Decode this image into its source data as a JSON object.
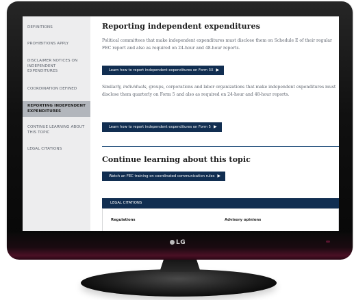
{
  "tv": {
    "brand": "LG"
  },
  "sidebar": {
    "items": [
      {
        "label": "DEFINITIONS",
        "active": false
      },
      {
        "label": "PROHIBITIONS APPLY",
        "active": false
      },
      {
        "label": "DISCLAIMER NOTICES ON INDEPENDENT EXPENDITURES",
        "active": false
      },
      {
        "label": "COORDINATION DEFINED",
        "active": false
      },
      {
        "label": "REPORTING INDEPENDENT EXPENDITURES",
        "active": true
      },
      {
        "label": "CONTINUE LEARNING ABOUT THIS TOPIC",
        "active": false
      },
      {
        "label": "LEGAL CITATIONS",
        "active": false
      }
    ]
  },
  "main": {
    "heading": "Reporting independent expenditures",
    "para1": "Political committees that make independent expenditures must disclose them on Schedule E of their regular FEC report and also as required on 24-hour and 48-hour reports.",
    "button1": "Learn how to report independent expenditures on Form 3X",
    "para2_lead": "Similarly, ",
    "para2_em": "individuals",
    "para2_rest": ", groups, corporations and labor organizations that make independent expenditures must disclose them quarterly on Form 5 and also as required on 24-hour and 48-hour reports.",
    "button2": "Learn how to report independent expenditures on Form 5",
    "continue_heading": "Continue learning about this topic",
    "button3": "Watch an FEC training on coordinated communication rules",
    "arrow": "▶"
  },
  "legal": {
    "title": "LEGAL CITATIONS",
    "col1": "Regulations",
    "col2": "Advisory opinions"
  }
}
